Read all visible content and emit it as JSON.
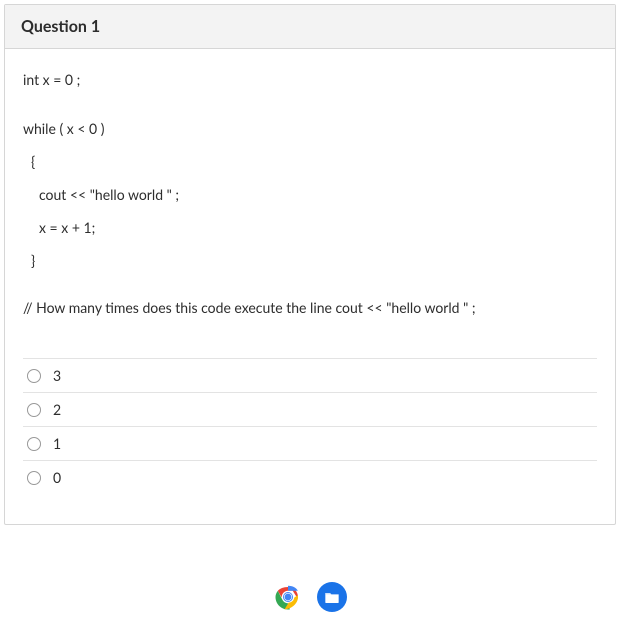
{
  "question": {
    "title": "Question 1",
    "code_lines": {
      "decl": "int x = 0 ;",
      "while": "while ( x <  0 )",
      "open_brace": "{",
      "stmt1": "cout << \"hello world \" ;",
      "stmt2": "x = x + 1;",
      "close_brace": "}"
    },
    "comment": "// How many times does this code execute the line cout << \"hello world \" ;",
    "options": [
      {
        "label": "3"
      },
      {
        "label": "2"
      },
      {
        "label": "1"
      },
      {
        "label": "0"
      }
    ]
  }
}
